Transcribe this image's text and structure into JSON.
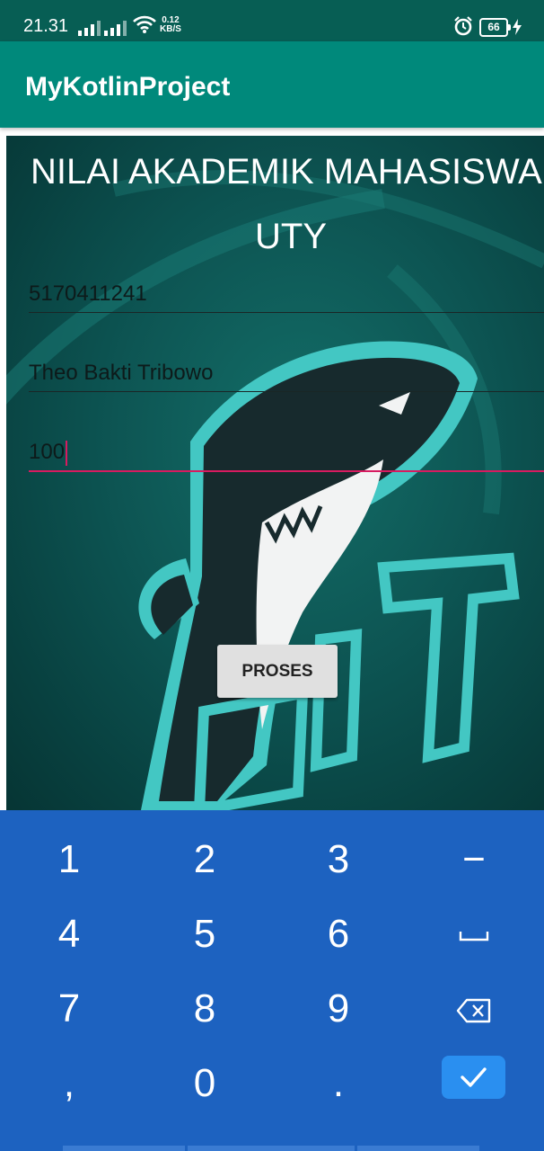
{
  "status_bar": {
    "time": "21.31",
    "net_speed_value": "0.12",
    "net_speed_unit": "KB/S",
    "battery": "66"
  },
  "app_bar": {
    "title": "MyKotlinProject"
  },
  "form": {
    "heading_line1": "NILAI AKADEMIK MAHASISWA",
    "heading_line2": "UTY",
    "nim_value": "5170411241",
    "name_value": "Theo Bakti Tribowo",
    "score_value": "100",
    "submit_label": "PROSES"
  },
  "keypad": {
    "keys": [
      "1",
      "2",
      "3",
      "−",
      "4",
      "5",
      "6",
      "⎵",
      "7",
      "8",
      "9",
      "⌫",
      ",",
      "0",
      "."
    ],
    "done_icon": "check-icon"
  },
  "colors": {
    "status_bar": "#075e54",
    "app_bar": "#00897b",
    "accent": "#d81b60",
    "keypad": "#1d62c0",
    "done_key": "#2a8ff0"
  }
}
